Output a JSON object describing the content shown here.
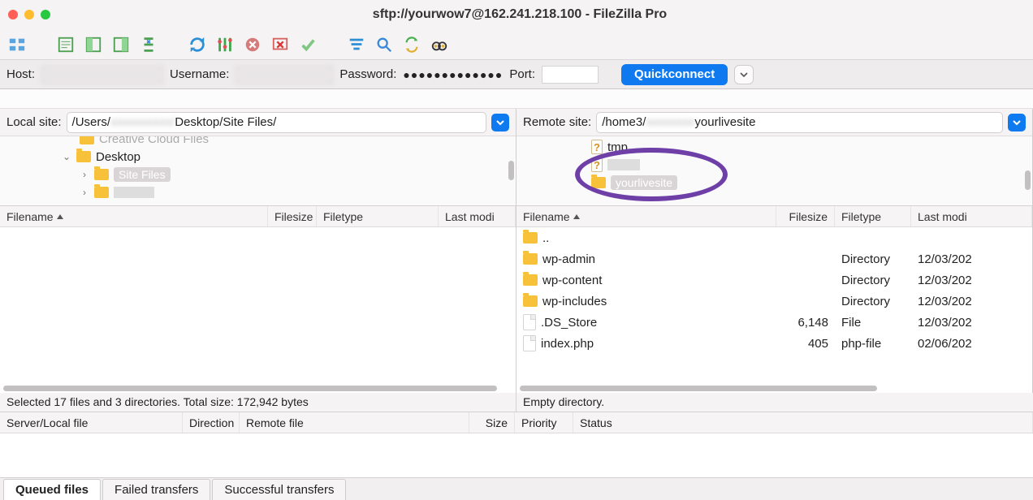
{
  "window": {
    "title": "sftp://yourwow7@162.241.218.100 - FileZilla Pro"
  },
  "quickconnect": {
    "host_label": "Host:",
    "user_label": "Username:",
    "pass_label": "Password:",
    "port_label": "Port:",
    "pass_value": "●●●●●●●●●●●●●",
    "button": "Quickconnect"
  },
  "local": {
    "site_label": "Local site:",
    "path_prefix": "/Users/",
    "path_suffix": "Desktop/Site Files/",
    "tree": {
      "truncated_top": "Creative Cloud Files",
      "desktop": "Desktop",
      "site_files": "Site Files"
    },
    "headers": {
      "filename": "Filename",
      "filesize": "Filesize",
      "filetype": "Filetype",
      "modified": "Last modi"
    },
    "status": "Selected 17 files and 3 directories. Total size: 172,942 bytes"
  },
  "remote": {
    "site_label": "Remote site:",
    "path_prefix": "/home3/",
    "path_suffix": "yourlivesite",
    "tree": {
      "tmp": "tmp",
      "selected": "yourlivesite"
    },
    "headers": {
      "filename": "Filename",
      "filesize": "Filesize",
      "filetype": "Filetype",
      "modified": "Last modi"
    },
    "files": [
      {
        "name": "..",
        "size": "",
        "type": "",
        "mod": "",
        "icon": "folder"
      },
      {
        "name": "wp-admin",
        "size": "",
        "type": "Directory",
        "mod": "12/03/202",
        "icon": "folder"
      },
      {
        "name": "wp-content",
        "size": "",
        "type": "Directory",
        "mod": "12/03/202",
        "icon": "folder"
      },
      {
        "name": "wp-includes",
        "size": "",
        "type": "Directory",
        "mod": "12/03/202",
        "icon": "folder"
      },
      {
        "name": ".DS_Store",
        "size": "6,148",
        "type": "File",
        "mod": "12/03/202",
        "icon": "file"
      },
      {
        "name": "index.php",
        "size": "405",
        "type": "php-file",
        "mod": "02/06/202",
        "icon": "file"
      }
    ],
    "status": "Empty directory."
  },
  "queue": {
    "headers": {
      "server": "Server/Local file",
      "dir": "Direction",
      "remote": "Remote file",
      "size": "Size",
      "prio": "Priority",
      "status": "Status"
    }
  },
  "tabs": {
    "queued": "Queued files",
    "failed": "Failed transfers",
    "success": "Successful transfers"
  }
}
